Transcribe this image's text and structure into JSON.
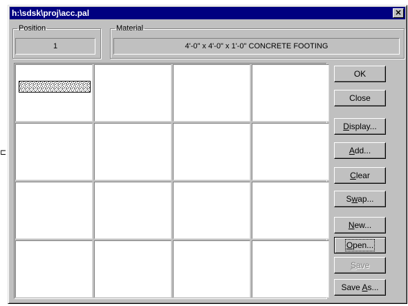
{
  "window": {
    "title": "h:\\sdsk\\proj\\acc.pal",
    "close_glyph": "✕"
  },
  "stray_glyph": "⊏",
  "position": {
    "label": "Position",
    "value": "1"
  },
  "material": {
    "label": "Material",
    "value": "4'-0\" x 4'-0\" x 1'-0\" CONCRETE FOOTING"
  },
  "grid": {
    "rows": 4,
    "cols": 4,
    "filled_cell": {
      "row": 0,
      "col": 0,
      "pattern": "concrete-stipple"
    }
  },
  "buttons": [
    {
      "id": "ok",
      "label": "OK",
      "mnemonic": null,
      "enabled": true,
      "default": false
    },
    {
      "id": "close",
      "label": "Close",
      "mnemonic": null,
      "enabled": true,
      "default": false
    },
    {
      "id": "display",
      "label": "Display...",
      "mnemonic": 0,
      "enabled": true,
      "default": false
    },
    {
      "id": "add",
      "label": "Add...",
      "mnemonic": 0,
      "enabled": true,
      "default": false
    },
    {
      "id": "clear",
      "label": "Clear",
      "mnemonic": 0,
      "enabled": true,
      "default": false
    },
    {
      "id": "swap",
      "label": "Swap...",
      "mnemonic": 1,
      "enabled": true,
      "default": false
    },
    {
      "id": "new",
      "label": "New...",
      "mnemonic": 0,
      "enabled": true,
      "default": false
    },
    {
      "id": "open",
      "label": "Open...",
      "mnemonic": 0,
      "enabled": true,
      "default": true
    },
    {
      "id": "save",
      "label": "Save",
      "mnemonic": 0,
      "enabled": false,
      "default": false
    },
    {
      "id": "save-as",
      "label": "Save As...",
      "mnemonic": 5,
      "enabled": true,
      "default": false
    }
  ]
}
